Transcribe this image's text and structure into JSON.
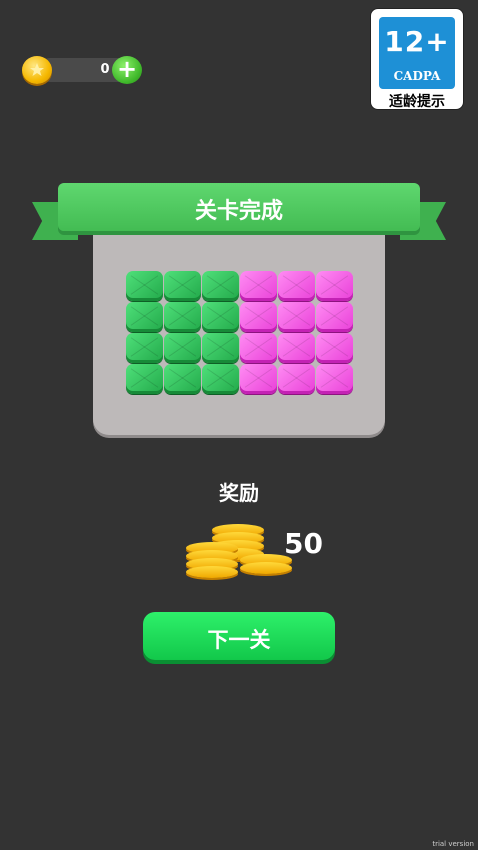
{
  "header": {
    "coins": "0",
    "coin_icon": "coin-icon",
    "add_icon": "plus-icon",
    "add_label": "+"
  },
  "age_rating": {
    "age": "12+",
    "org": "CADPA",
    "hint": "适龄提示"
  },
  "level_complete": {
    "title": "关卡完成",
    "grid": {
      "rows": 4,
      "cols": 6,
      "pattern": [
        "green",
        "green",
        "green",
        "pink",
        "pink",
        "pink"
      ]
    }
  },
  "reward": {
    "label": "奖励",
    "amount": "50",
    "icon": "coin-stack-icon"
  },
  "next_button": {
    "label": "下一关"
  },
  "footer": {
    "watermark": "trial version"
  },
  "colors": {
    "background": "#333333",
    "ribbon": "#4cc75b",
    "panel": "#bdb9b9",
    "green_block": "#2ebd58",
    "pink_block": "#f05ce2",
    "button": "#1ad957"
  }
}
